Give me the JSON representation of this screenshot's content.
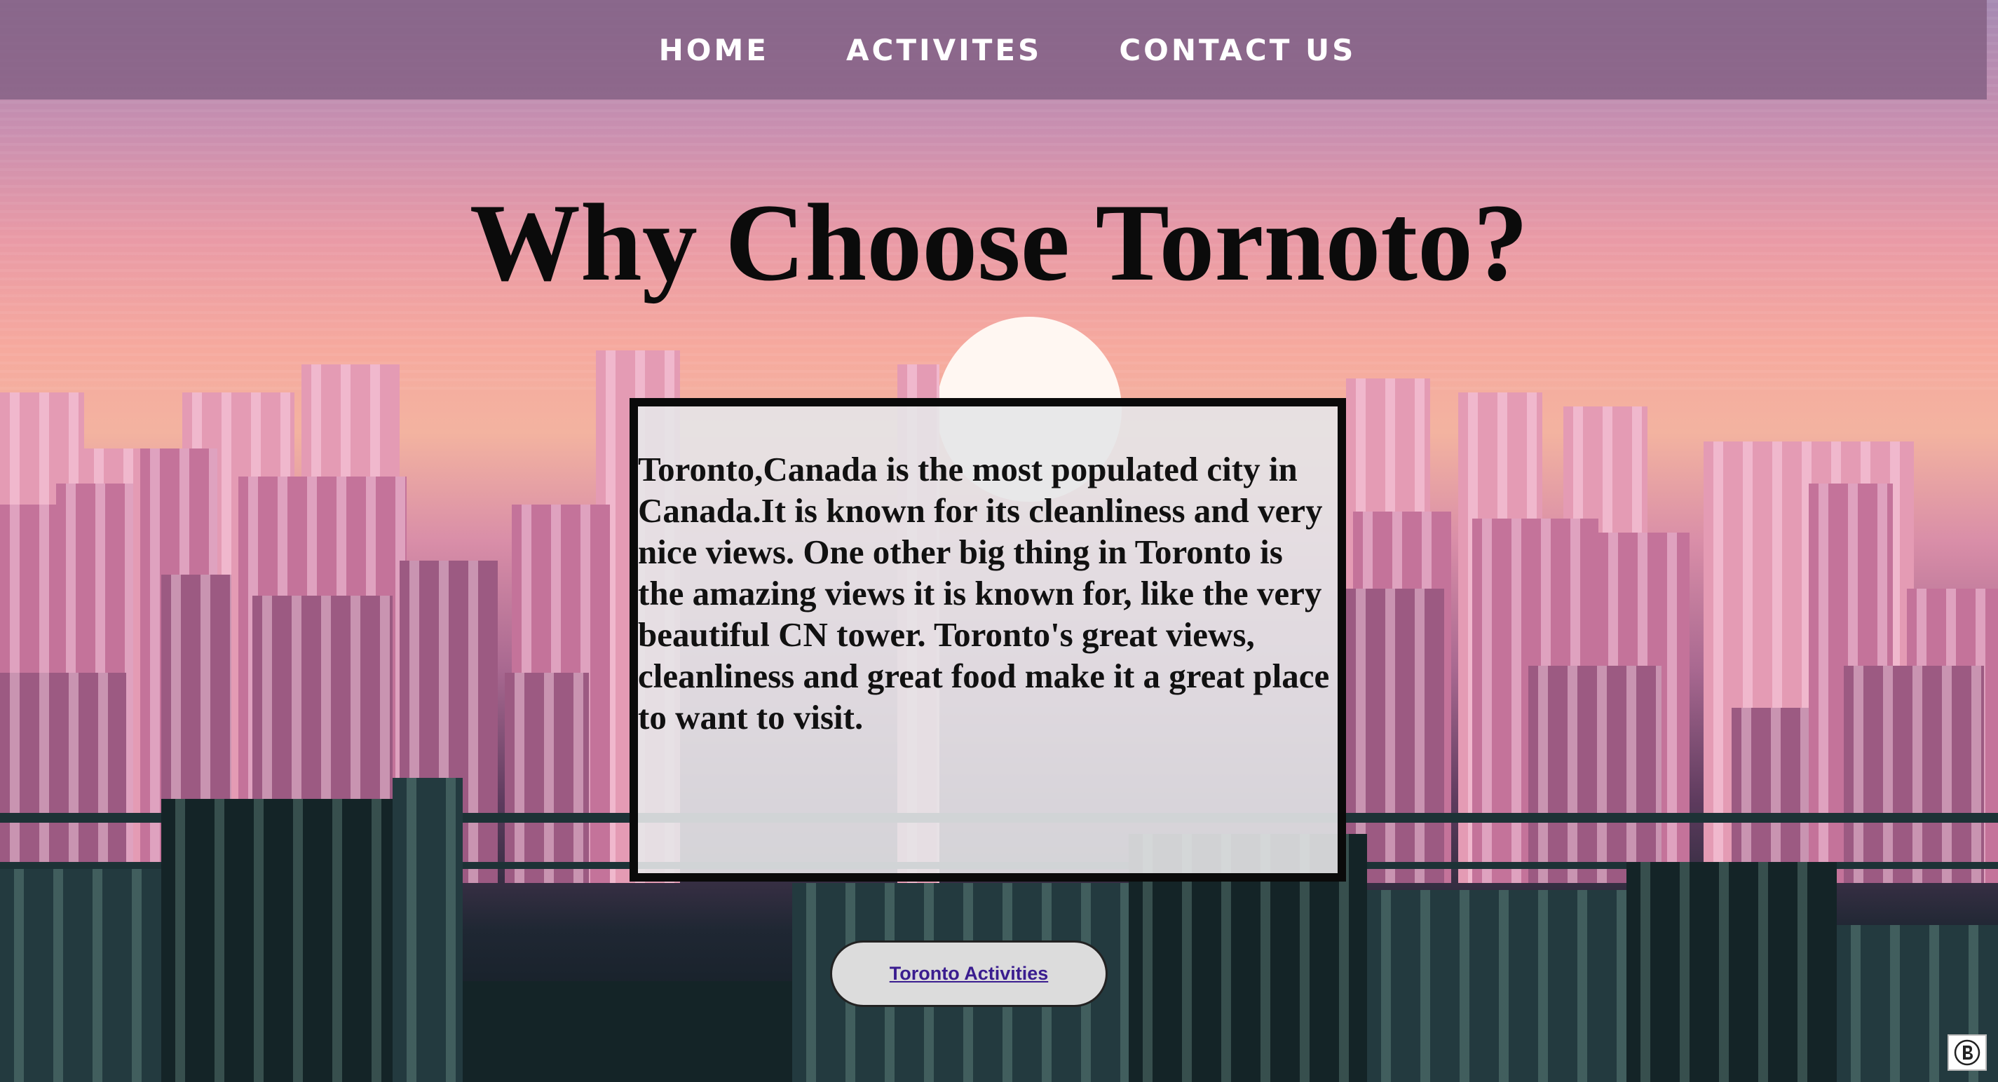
{
  "nav": {
    "items": [
      "HOME",
      "ACTIVITES",
      "CONTACT US"
    ]
  },
  "hero": {
    "title": "Why Choose Tornoto?"
  },
  "card": {
    "text": "Toronto,Canada is the most populated city in Canada.It is known for its cleanliness and very nice views. One other big thing in Toronto is the amazing views it is known for, like the very beautiful CN tower. Toronto's great views, cleanliness and great food make it a great place to want to visit."
  },
  "cta": {
    "label": "Toronto Activities"
  },
  "badge": {
    "icon": "b-circle-icon"
  },
  "colors": {
    "nav_bg": "#825f82",
    "title": "#0b0b0b",
    "card_border": "#0a0a0a",
    "link": "#3a1d8f"
  }
}
